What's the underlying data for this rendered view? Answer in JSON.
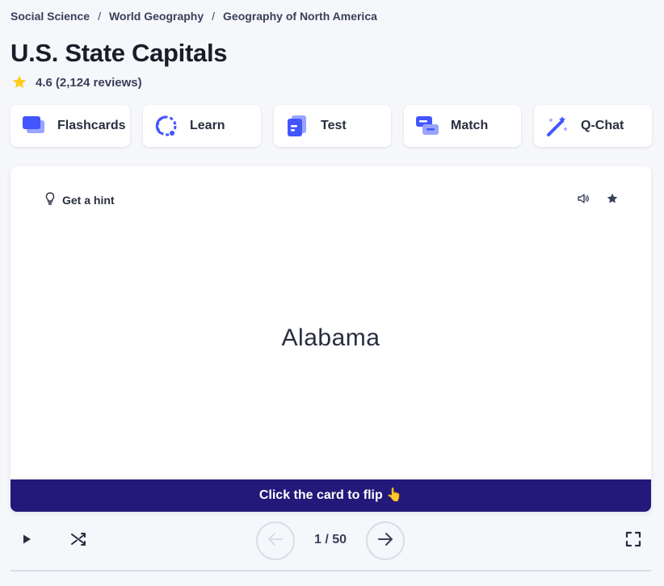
{
  "breadcrumb": {
    "items": [
      "Social Science",
      "World Geography",
      "Geography of North America"
    ],
    "separator": "/"
  },
  "set": {
    "title": "U.S. State Capitals",
    "rating": "4.6",
    "reviews": "(2,124 reviews)"
  },
  "modes": [
    {
      "label": "Flashcards",
      "icon": "flashcards-icon"
    },
    {
      "label": "Learn",
      "icon": "learn-icon"
    },
    {
      "label": "Test",
      "icon": "test-icon"
    },
    {
      "label": "Match",
      "icon": "match-icon"
    },
    {
      "label": "Q-Chat",
      "icon": "q-chat-icon"
    }
  ],
  "card": {
    "hint_label": "Get a hint",
    "term": "Alabama",
    "flip_prompt": "Click the card to flip 👆"
  },
  "controls": {
    "counter": "1 / 50"
  },
  "colors": {
    "accent": "#4255ff",
    "flip_bar": "#23197a",
    "star": "#ffcd1f",
    "background": "#f6f7fb"
  }
}
